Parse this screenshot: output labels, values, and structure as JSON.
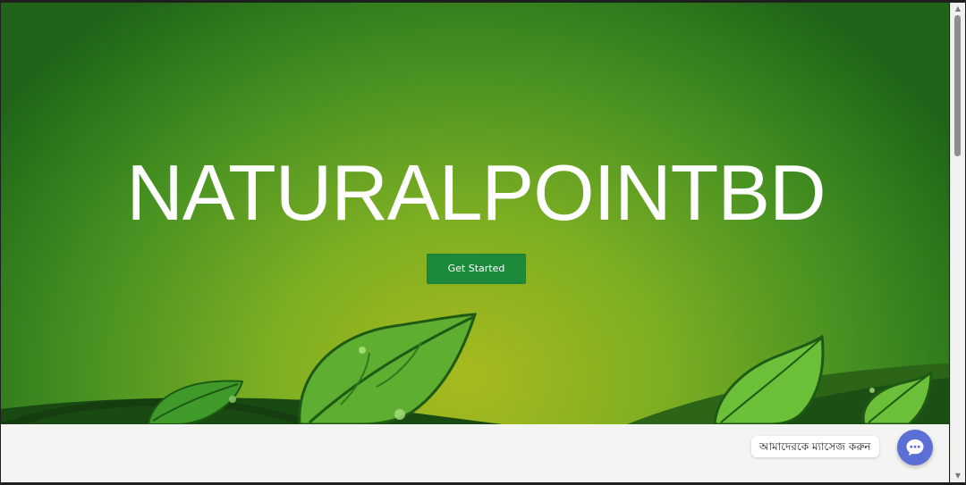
{
  "hero": {
    "title": "NATURALPOINTBD",
    "cta_label": "Get Started"
  },
  "chat": {
    "label": "আমাদেরকে ম্যাসেজ করুন",
    "icon": "chat-bubble-icon",
    "color": "#5b6fd6"
  },
  "colors": {
    "hero_gradient_center": "#a8ba1e",
    "hero_gradient_edge": "#1f6419",
    "button": "#1d8a3b"
  },
  "scrollbar": {
    "up_glyph": "▲",
    "down_glyph": "▼"
  }
}
